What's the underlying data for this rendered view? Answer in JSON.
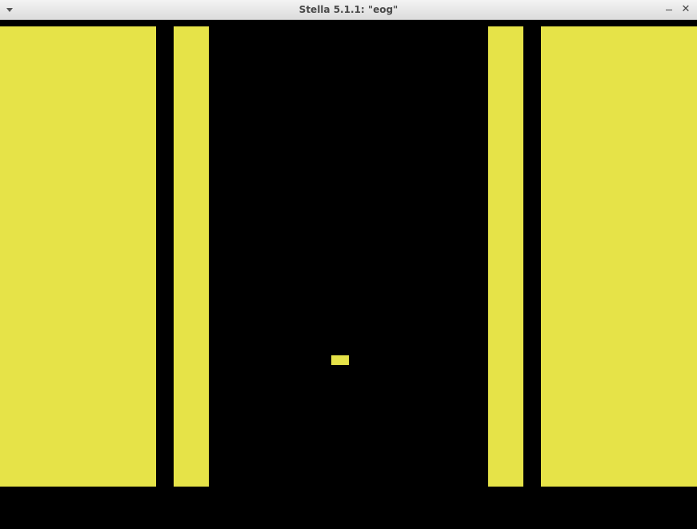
{
  "window": {
    "title": "Stella 5.1.1: \"eog\"",
    "menu_icon": "chevron-down-icon",
    "minimize_icon": "minimize-icon",
    "close_icon": "close-icon",
    "close_glyph": "✕"
  },
  "game": {
    "background_color": "#000000",
    "playfield_color": "#e6e348"
  }
}
